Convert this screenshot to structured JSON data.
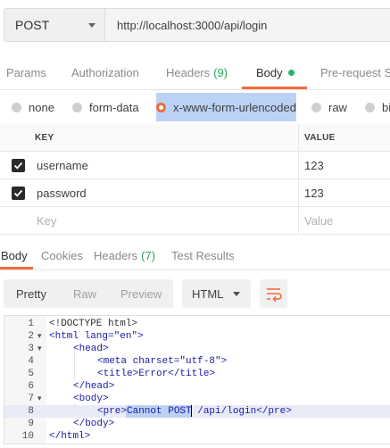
{
  "request": {
    "method": "POST",
    "url": "http://localhost:3000/api/login"
  },
  "request_tabs": [
    {
      "label": "Params"
    },
    {
      "label": "Authorization"
    },
    {
      "label": "Headers",
      "count": "(9)"
    },
    {
      "label": "Body"
    },
    {
      "label": "Pre-request Sc"
    }
  ],
  "body_types": [
    {
      "label": "none"
    },
    {
      "label": "form-data"
    },
    {
      "label": "x-www-form-urlencoded"
    },
    {
      "label": "raw"
    },
    {
      "label": "bi"
    }
  ],
  "params_table": {
    "headers": [
      "KEY",
      "VALUE"
    ],
    "rows": [
      {
        "key": "username",
        "value": "123"
      },
      {
        "key": "password",
        "value": "123"
      }
    ],
    "placeholder_key": "Key",
    "placeholder_value": "Value"
  },
  "response_tabs": [
    {
      "label": "Body"
    },
    {
      "label": "Cookies"
    },
    {
      "label": "Headers",
      "count": "(7)"
    },
    {
      "label": "Test Results"
    }
  ],
  "response_toolbar": {
    "view_modes": [
      "Pretty",
      "Raw",
      "Preview"
    ],
    "format": "HTML"
  },
  "response_body": {
    "line_numbers": [
      "1",
      "2",
      "3",
      "4",
      "5",
      "6",
      "7",
      "8",
      "9",
      "10"
    ],
    "lines": [
      "<!DOCTYPE html>",
      "<html lang=\"en\">",
      "<head>",
      "<meta charset=\"utf-8\">",
      "<title>Error</title>",
      "</head>",
      "<body>",
      "<pre>Cannot POST /api/login</pre>",
      "</body>",
      "</html>"
    ]
  },
  "colors": {
    "accent": "#f26b3a",
    "status_dot": "#26b56d",
    "count": "#26a65b"
  }
}
